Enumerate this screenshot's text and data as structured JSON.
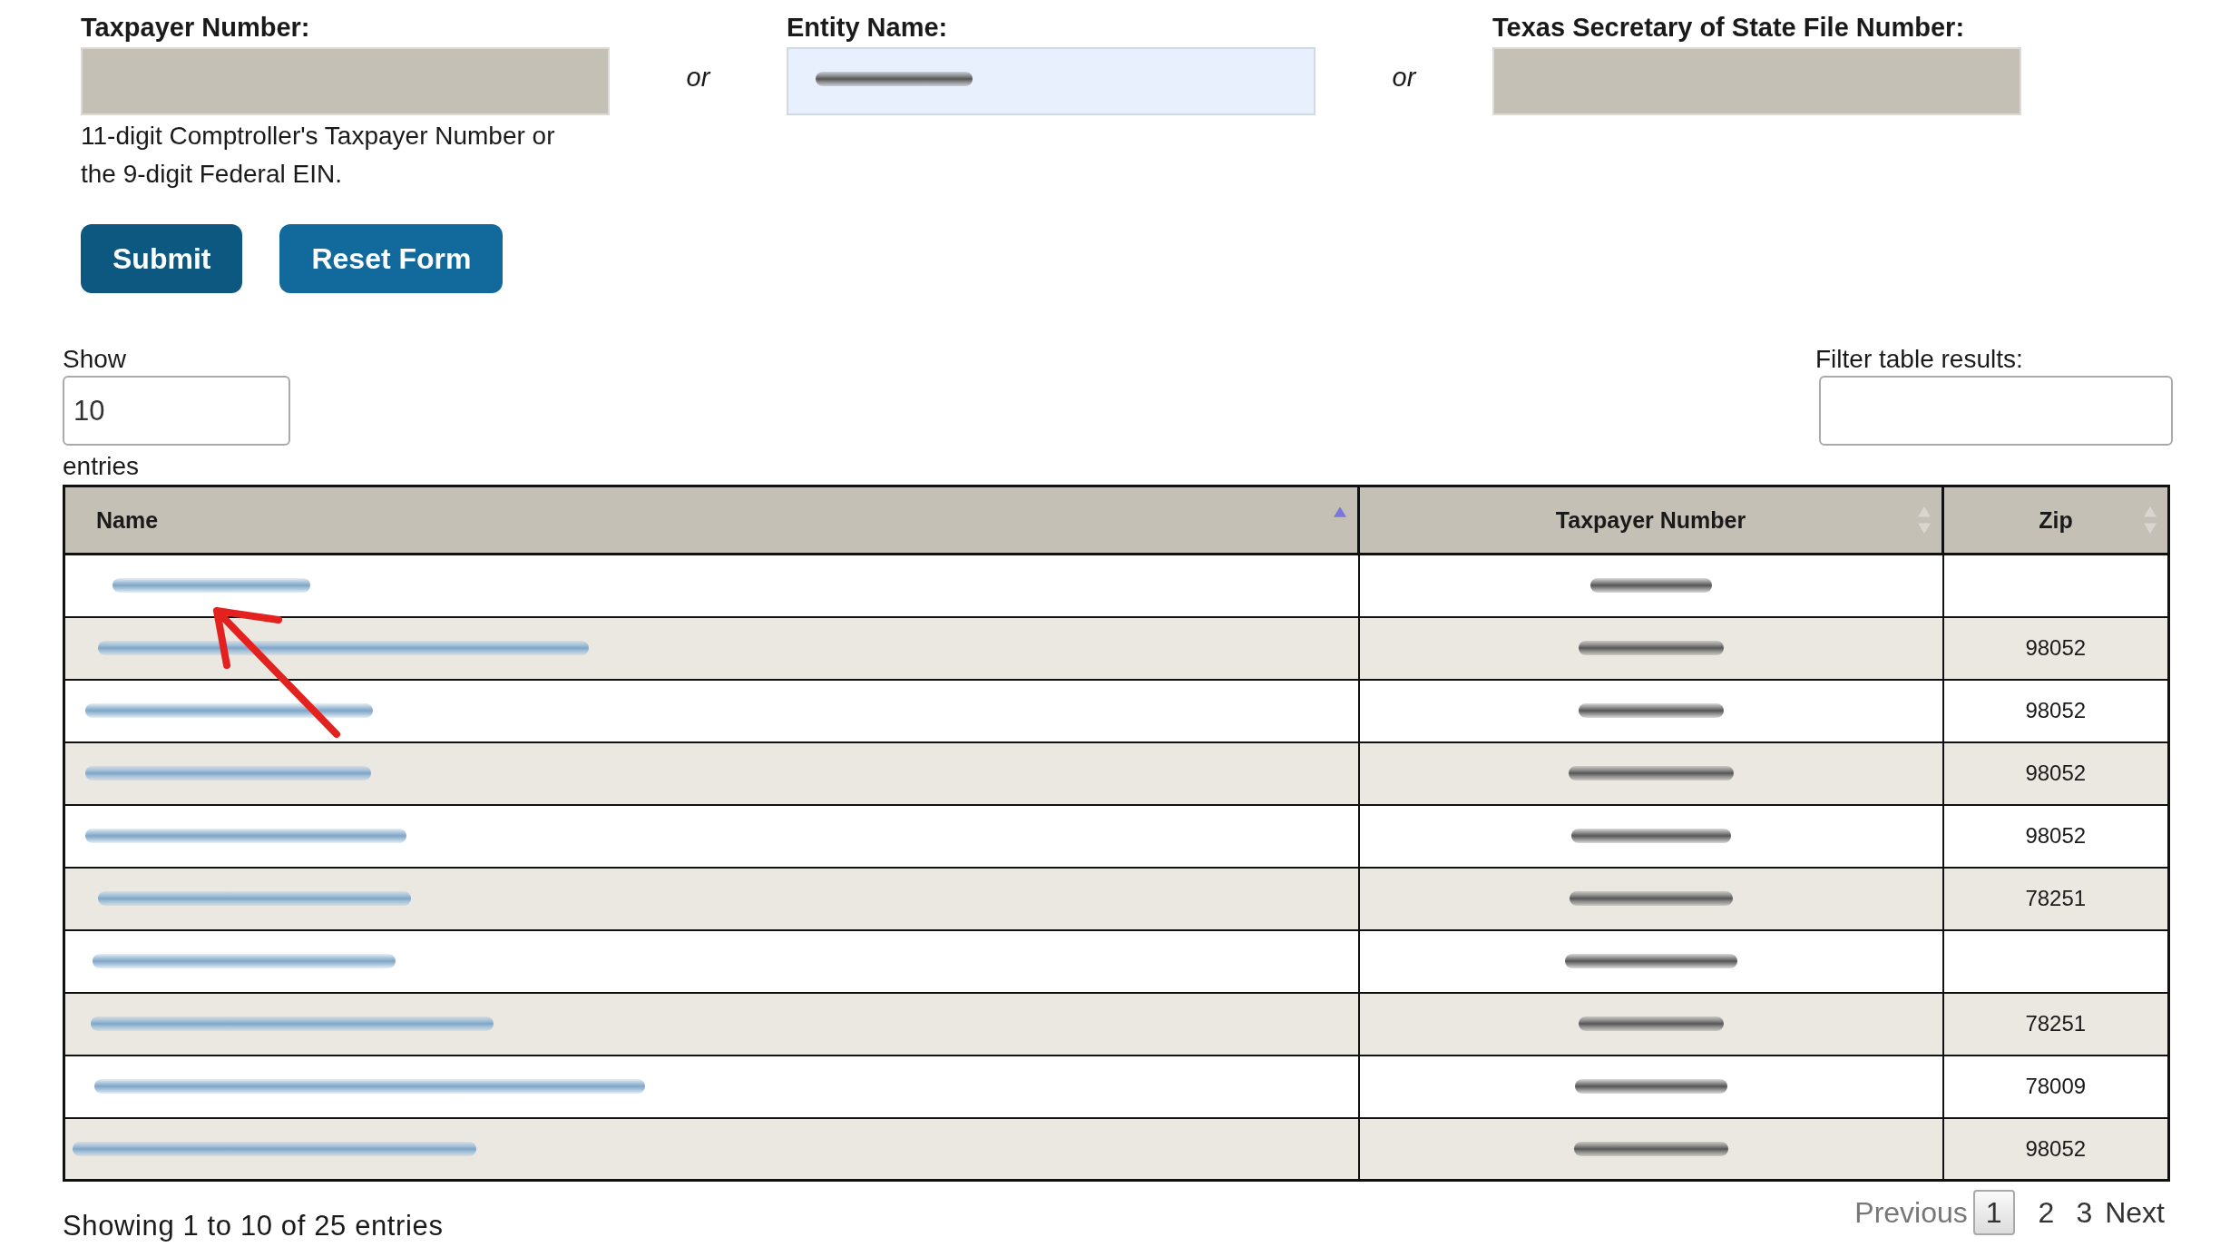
{
  "search_form": {
    "fields": [
      {
        "label": "Taxpayer Number:",
        "disabled": true,
        "hint": "11-digit Comptroller's Taxpayer Number or the 9-digit Federal EIN."
      },
      {
        "label": "Entity Name:",
        "disabled": false,
        "value_blurred": true
      },
      {
        "label": "Texas Secretary of State File Number:",
        "disabled": true
      }
    ],
    "separators": [
      "or",
      "or"
    ],
    "buttons": [
      {
        "label": "Submit",
        "kind": "primary"
      },
      {
        "label": "Reset Form",
        "kind": "secondary"
      }
    ]
  },
  "length_menu": {
    "label": "Show",
    "value": "10",
    "suffix": "entries"
  },
  "filter": {
    "label": "Filter table results:"
  },
  "table": {
    "columns": [
      {
        "label": "Name",
        "sorted_ascending": true
      },
      {
        "label": "Taxpayer Number",
        "sorted_ascending": false
      },
      {
        "label": "Zip",
        "sorted_ascending": false
      }
    ],
    "rows": [
      {
        "name_blurred": true,
        "taxpayer_number_blurred": true
      },
      {
        "name_blurred": true,
        "taxpayer_number_blurred": true,
        "zip": "98052"
      },
      {
        "name_blurred": true,
        "taxpayer_number_blurred": true,
        "zip": "98052"
      },
      {
        "name_blurred": true,
        "taxpayer_number_blurred": true,
        "zip": "98052"
      },
      {
        "name_blurred": true,
        "taxpayer_number_blurred": true,
        "zip": "98052"
      },
      {
        "name_blurred": true,
        "taxpayer_number_blurred": true,
        "zip": "78251"
      },
      {
        "name_blurred": true,
        "taxpayer_number_blurred": true
      },
      {
        "name_blurred": true,
        "taxpayer_number_blurred": true,
        "zip": "78251"
      },
      {
        "name_blurred": true,
        "taxpayer_number_blurred": true,
        "zip": "78009"
      },
      {
        "name_blurred": true,
        "taxpayer_number_blurred": true,
        "zip": "98052"
      }
    ]
  },
  "info": "Showing 1 to 10 of 25 entries",
  "pagination": {
    "previous": {
      "label": "Previous",
      "disabled": true
    },
    "pages": [
      {
        "label": "1",
        "selected": true
      },
      {
        "label": "2",
        "selected": false
      },
      {
        "label": "3",
        "selected": false
      }
    ],
    "next": {
      "label": "Next",
      "disabled": false
    }
  },
  "annotation": {
    "kind": "arrow"
  }
}
